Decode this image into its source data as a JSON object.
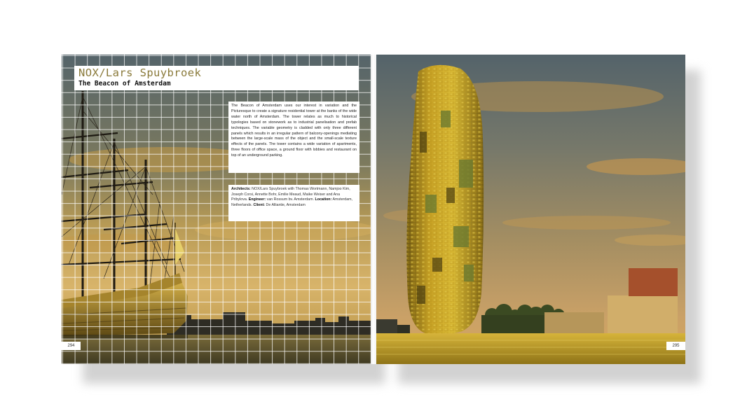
{
  "spread": {
    "left_page": {
      "header": {
        "author": "NOX/Lars Spuybroek",
        "project_title": "The Beacon of Amsterdam"
      },
      "description": "The Beacon of Amsterdam uses our interest in variation and the Picturesque to create a signature residential tower at the banks of the wide water north of Amsterdam. The tower relates as much to historical typologies based on stonework as to industrial panelisation and prefab techniques. The variable geometry is cladded with only three different panels which results in an irregular pattern of balcony-openings mediating between the large-scale mass of the object and the small-scale texture effects of the panels. The tower contains a wide variation of apartments, three floors of office space, a ground floor with lobbies and restaurant on top of an underground parking.",
      "credits": {
        "architects_label": "Architects:",
        "architects_value": "NOX/Lars Spuybroek with Thomas Wortmann, Namjoo Kim, Joseph Corsi, Annette Bohr, Emilie Meaud, Maike Weiser and Ana Pribylova.",
        "engineer_label": "Engineer:",
        "engineer_value": "van Rossum bv. Amsterdam.",
        "location_label": "Location:",
        "location_value": "Amsterdam, Netherlands.",
        "client_label": "Client:",
        "client_value": "De Alliantie, Amsterdam"
      },
      "page_number": "294"
    },
    "right_page": {
      "page_number": "295"
    }
  },
  "colors": {
    "sky_top": "#5b6a6e",
    "sunset_gold": "#d9a640",
    "water": "#b9961f",
    "tower_gold": "#c7a125",
    "author_text": "#8a7a3a"
  }
}
